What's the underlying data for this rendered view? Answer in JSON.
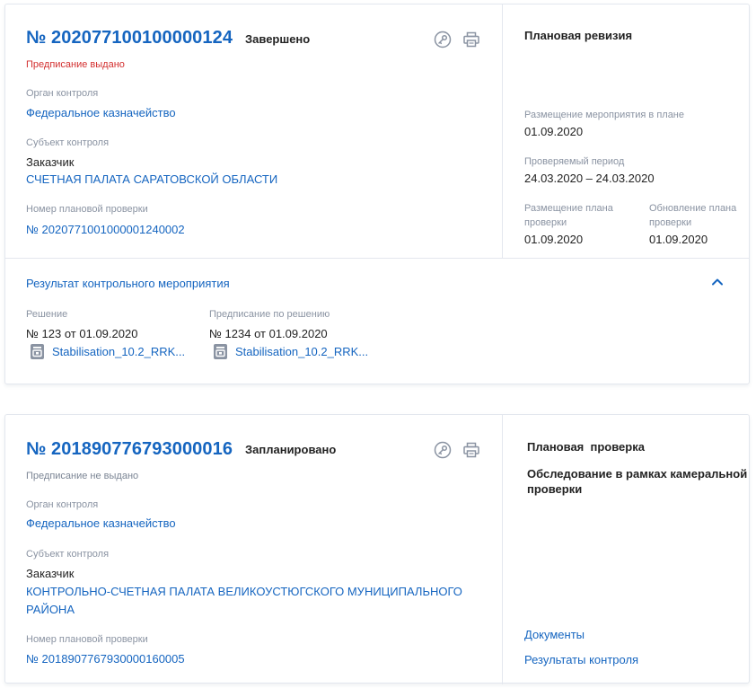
{
  "cards": [
    {
      "number": "№ 202077100100000124",
      "status": "Завершено",
      "prescription": "Предписание выдано",
      "prescription_color": "#d32f2f",
      "control_body_label": "Орган контроля",
      "control_body": "Федеральное казначейство",
      "subject_label": "Субъект контроля",
      "subject_role": "Заказчик",
      "subject_name": "СЧЕТНАЯ ПАЛАТА САРАТОВСКОЙ ОБЛАСТИ",
      "plan_number_label": "Номер плановой проверки",
      "plan_number": "№ 2020771001000001240002",
      "side": {
        "type": "Плановая ревизия",
        "placement_label": "Размещение мероприятия в плане",
        "placement": "01.09.2020",
        "period_label": "Проверяемый период",
        "period": "24.03.2020 – 24.03.2020",
        "plan_placement_label_1": "Размещение плана",
        "plan_placement_label_2": "проверки",
        "plan_placement": "01.09.2020",
        "plan_update_label_1": "Обновление плана",
        "plan_update_label_2": "проверки",
        "plan_update": "01.09.2020"
      },
      "result": {
        "title": "Результат контрольного мероприятия",
        "decision_label": "Решение",
        "decision": "№ 123 от 01.09.2020",
        "decision_file": "Stabilisation_10.2_RRK...",
        "order_label": "Предписание по решению",
        "order": "№ 1234 от 01.09.2020",
        "order_file": "Stabilisation_10.2_RRK..."
      }
    },
    {
      "number": "№ 201890776793000016",
      "status": "Запланировано",
      "prescription": "Предписание не выдано",
      "control_body_label": "Орган контроля",
      "control_body": "Федеральное казначейство",
      "subject_label": "Субъект контроля",
      "subject_role": "Заказчик",
      "subject_name_1": "КОНТРОЛЬНО-СЧЕТНАЯ ПАЛАТА ВЕЛИКОУСТЮГСКОГО МУНИЦИПАЛЬНОГО",
      "subject_name_2": "РАЙОНА",
      "plan_number_label": "Номер плановой проверки",
      "plan_number": "№ 2018907767930000160005",
      "side": {
        "type": "Плановая  проверка",
        "subtype_1": "Обследование в рамках камеральной",
        "subtype_2": "проверки",
        "documents": "Документы",
        "results": "Результаты контроля"
      }
    }
  ],
  "colors": {
    "link": "#1565c0",
    "icon": "#8a93a2",
    "border": "#e3e7ee"
  },
  "icons": {
    "key": "key-icon",
    "print": "print-icon",
    "chevron": "chevron-up-icon",
    "file": "archive-file-icon"
  }
}
